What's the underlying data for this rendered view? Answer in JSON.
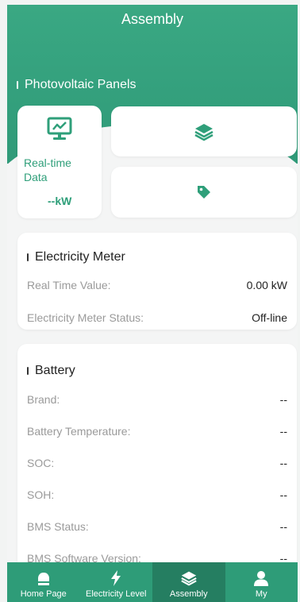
{
  "header": {
    "title": "Assembly"
  },
  "pv": {
    "section_title": "Photovoltaic Panels",
    "realtime_label": "Real-time Data",
    "realtime_value": "--kW"
  },
  "meter": {
    "title": "Electricity Meter",
    "rows": [
      {
        "label": "Real Time Value:",
        "value": "0.00 kW"
      },
      {
        "label": "Electricity Meter Status:",
        "value": "Off-line"
      }
    ]
  },
  "battery": {
    "title": "Battery",
    "rows": [
      {
        "label": "Brand:",
        "value": "--"
      },
      {
        "label": "Battery Temperature:",
        "value": "--"
      },
      {
        "label": "SOC:",
        "value": "--"
      },
      {
        "label": "SOH:",
        "value": "--"
      },
      {
        "label": "BMS Status:",
        "value": "--"
      },
      {
        "label": "BMS Software Version:",
        "value": "--"
      }
    ]
  },
  "nav": {
    "items": [
      {
        "label": "Home Page",
        "icon": "home-icon"
      },
      {
        "label": "Electricity Level",
        "icon": "bolt-icon"
      },
      {
        "label": "Assembly",
        "icon": "layers-icon",
        "active": true
      },
      {
        "label": "My",
        "icon": "user-icon"
      }
    ]
  },
  "colors": {
    "brand": "#2f9f7a",
    "nav_active": "#257e61"
  }
}
